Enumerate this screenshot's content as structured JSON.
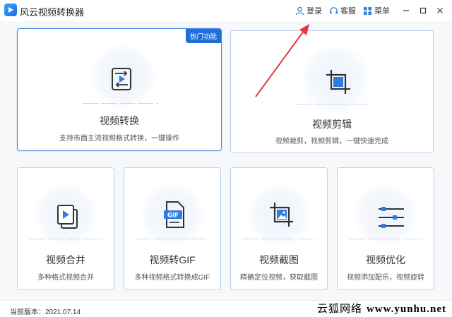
{
  "app": {
    "title": "风云视频转换器"
  },
  "titlebar": {
    "login": "登录",
    "service": "客服",
    "menu": "菜单"
  },
  "cards": [
    {
      "key": "convert",
      "title": "视频转换",
      "subtitle": "支持市面主流视频格式转换，一键操作",
      "badge": "热门功能",
      "icon": "convert-icon"
    },
    {
      "key": "edit",
      "title": "视频剪辑",
      "subtitle": "视频裁剪，视频剪辑，一键快速完成",
      "icon": "crop-icon"
    },
    {
      "key": "merge",
      "title": "视频合并",
      "subtitle": "多种格式视频合并",
      "icon": "merge-icon"
    },
    {
      "key": "gif",
      "title": "视频转GIF",
      "subtitle": "多种视频格式转换成GIF",
      "icon": "gif-icon",
      "icon_text": "GIF"
    },
    {
      "key": "screenshot",
      "title": "视频截图",
      "subtitle": "精确定位视频，获取截图",
      "icon": "screenshot-icon"
    },
    {
      "key": "optimize",
      "title": "视频优化",
      "subtitle": "视频添加配乐，视频旋转",
      "icon": "equalizer-icon"
    }
  ],
  "status": {
    "version": "当前版本：2021.07.14"
  },
  "watermark": {
    "text": "云狐网络",
    "url": "www.yunhu.net"
  },
  "colors": {
    "accent": "#1e6fd9",
    "icon_blue": "#2f7de1",
    "arrow": "#e23b3b",
    "card_border": "#b9cfee"
  }
}
